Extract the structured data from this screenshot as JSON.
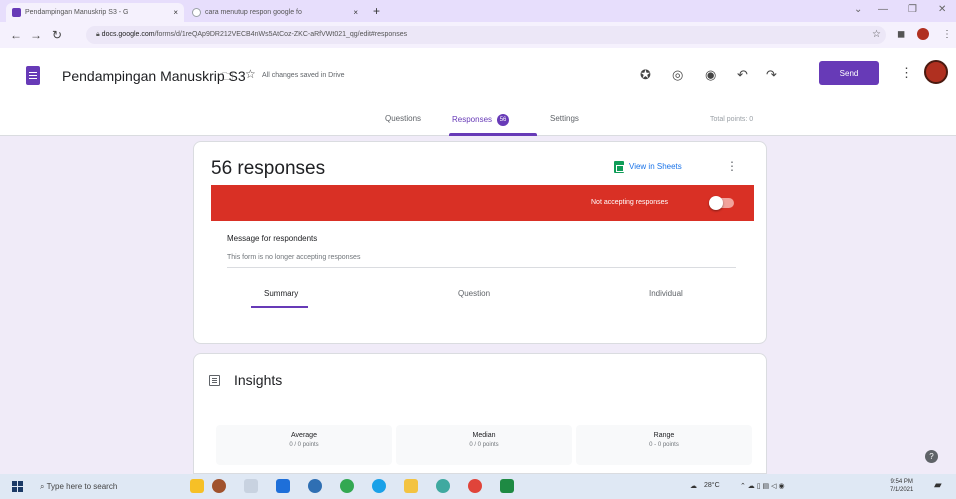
{
  "browser": {
    "tabs": [
      {
        "title": "Pendampingan Manuskrip S3 - G",
        "active": true,
        "favicon_color": "#673ab7"
      },
      {
        "title": "cara menutup respon google fo",
        "active": false,
        "favicon_color": "#9aa0a6"
      }
    ],
    "new_tab_label": "+",
    "address": {
      "host": "docs.google.com",
      "path": "/forms/d/1reQAp9DR212VECB4nWs5AtCoz-ZKC-aRfVWt021_qg/edit#responses"
    }
  },
  "forms": {
    "title": "Pendampingan Manuskrip S3",
    "saved_status": "All changes saved in Drive",
    "send_label": "Send",
    "tabs": {
      "questions": "Questions",
      "responses": "Responses",
      "responses_count": "56",
      "settings": "Settings"
    },
    "total_points": "Total points: 0"
  },
  "responses": {
    "count_label": "56 responses",
    "view_sheets_label": "View in Sheets",
    "not_accepting_label": "Not accepting responses",
    "accepting": false,
    "message_title": "Message for respondents",
    "message_text": "This form is no longer accepting responses",
    "subtabs": {
      "summary": "Summary",
      "question": "Question",
      "individual": "Individual"
    }
  },
  "insights": {
    "title": "Insights",
    "stats": [
      {
        "label": "Average",
        "value": "0 / 0 points"
      },
      {
        "label": "Median",
        "value": "0 / 0 points"
      },
      {
        "label": "Range",
        "value": "0 - 0 points"
      }
    ]
  },
  "taskbar": {
    "search_placeholder": "Type here to search",
    "weather": "28°C",
    "time": "9:54 PM",
    "date": "7/1/2021"
  },
  "colors": {
    "accent": "#673ab7",
    "banner": "#d93025",
    "sheets": "#0f9d58"
  }
}
